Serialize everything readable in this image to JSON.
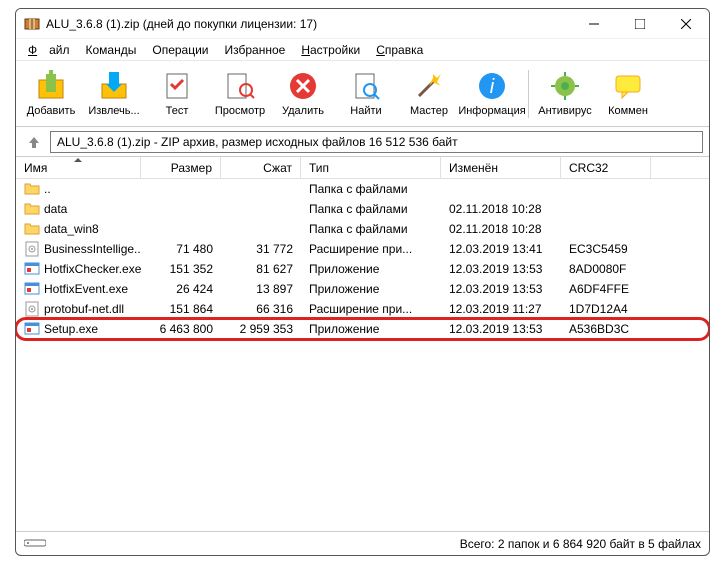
{
  "window": {
    "title": "ALU_3.6.8 (1).zip (дней до покупки лицензии: 17)"
  },
  "menu": {
    "file": "Файл",
    "commands": "Команды",
    "operations": "Операции",
    "favorites": "Избранное",
    "settings": "Настройки",
    "help": "Справка"
  },
  "toolbar": {
    "add": "Добавить",
    "extract": "Извлечь...",
    "test": "Тест",
    "view": "Просмотр",
    "delete": "Удалить",
    "find": "Найти",
    "wizard": "Мастер",
    "info": "Информация",
    "antivirus": "Антивирус",
    "comment": "Коммен"
  },
  "path": {
    "value": "ALU_3.6.8 (1).zip - ZIP архив, размер исходных файлов 16 512 536 байт"
  },
  "columns": {
    "name": "Имя",
    "size": "Размер",
    "packed": "Сжат",
    "type": "Тип",
    "modified": "Изменён",
    "crc": "CRC32"
  },
  "files": [
    {
      "icon": "folder-up",
      "name": "..",
      "size": "",
      "packed": "",
      "type": "Папка с файлами",
      "modified": "",
      "crc": "",
      "hl": false
    },
    {
      "icon": "folder",
      "name": "data",
      "size": "",
      "packed": "",
      "type": "Папка с файлами",
      "modified": "02.11.2018 10:28",
      "crc": "",
      "hl": false
    },
    {
      "icon": "folder",
      "name": "data_win8",
      "size": "",
      "packed": "",
      "type": "Папка с файлами",
      "modified": "02.11.2018 10:28",
      "crc": "",
      "hl": false
    },
    {
      "icon": "dll",
      "name": "BusinessIntellige...",
      "size": "71 480",
      "packed": "31 772",
      "type": "Расширение при...",
      "modified": "12.03.2019 13:41",
      "crc": "EC3C5459",
      "hl": false
    },
    {
      "icon": "exe",
      "name": "HotfixChecker.exe",
      "size": "151 352",
      "packed": "81 627",
      "type": "Приложение",
      "modified": "12.03.2019 13:53",
      "crc": "8AD0080F",
      "hl": false
    },
    {
      "icon": "exe",
      "name": "HotfixEvent.exe",
      "size": "26 424",
      "packed": "13 897",
      "type": "Приложение",
      "modified": "12.03.2019 13:53",
      "crc": "A6DF4FFE",
      "hl": false
    },
    {
      "icon": "dll",
      "name": "protobuf-net.dll",
      "size": "151 864",
      "packed": "66 316",
      "type": "Расширение при...",
      "modified": "12.03.2019 11:27",
      "crc": "1D7D12A4",
      "hl": false
    },
    {
      "icon": "exe",
      "name": "Setup.exe",
      "size": "6 463 800",
      "packed": "2 959 353",
      "type": "Приложение",
      "modified": "12.03.2019 13:53",
      "crc": "A536BD3C",
      "hl": true
    }
  ],
  "statusbar": {
    "summary": "Всего: 2 папок и 6 864 920 байт в 5 файлах"
  }
}
